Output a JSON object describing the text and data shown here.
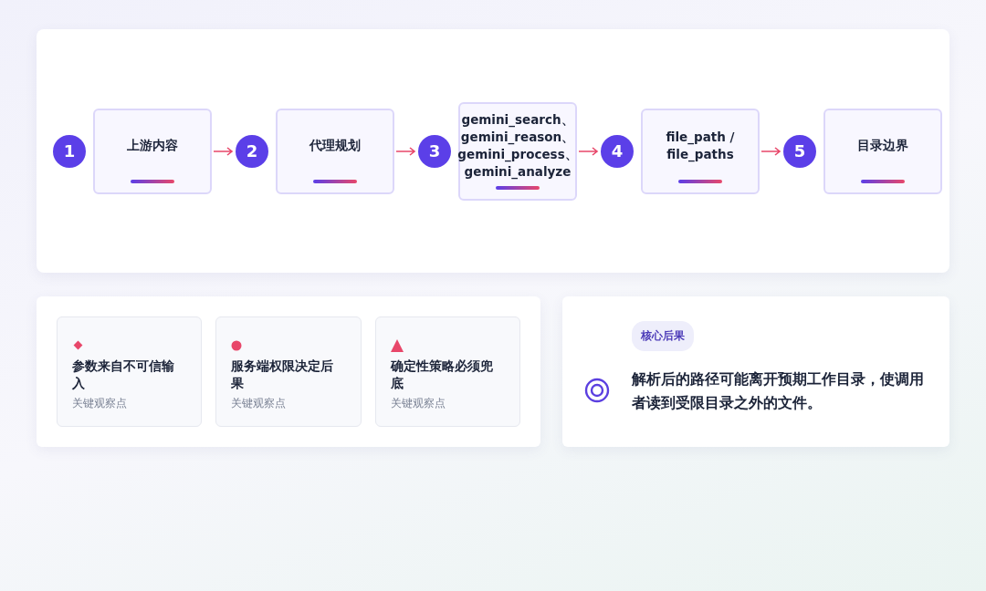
{
  "flow": {
    "steps": [
      {
        "number": "1",
        "label": "上游内容"
      },
      {
        "number": "2",
        "label": "代理规划"
      },
      {
        "number": "3",
        "label": "gemini_search、gemini_reason、gemini_process、gemini_analyze"
      },
      {
        "number": "4",
        "label": "file_path / file_paths"
      },
      {
        "number": "5",
        "label": "目录边界"
      }
    ]
  },
  "observations": [
    {
      "kind": "diamond",
      "title": "参数来自不可信输入",
      "caption": "关键观察点"
    },
    {
      "kind": "circle",
      "title": "服务端权限决定后果",
      "caption": "关键观察点"
    },
    {
      "kind": "triangle",
      "title": "确定性策略必须兜底",
      "caption": "关键观察点"
    }
  ],
  "outcome": {
    "badge": "核心后果",
    "text": "解析后的路径可能离开预期工作目录，使调用者读到受限目录之外的文件。"
  }
}
